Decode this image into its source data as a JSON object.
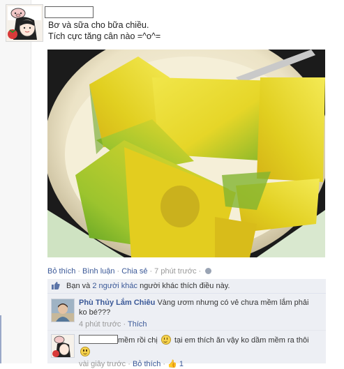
{
  "post": {
    "status_line_1": "Bơ và sữa cho bữa chiều.",
    "status_line_2": "Tích cực tăng cân nào =^o^=",
    "photo_icon": "photo"
  },
  "actions": {
    "like": "Bỏ thích",
    "comment": "Bình luận",
    "share": "Chia sẻ",
    "time": "7 phút trước",
    "separator": "·",
    "privacy_icon": "globe-icon"
  },
  "likes": {
    "prefix": "Bạn và ",
    "others_link": "2 người khác",
    "suffix": " người khác thích điều này.",
    "icon": "thumbs-up-icon"
  },
  "comments": [
    {
      "author": "Phù Thủy Lắm Chiêu",
      "text": "Vàng ươm nhưng có vẻ chưa mềm lắm phải ko bé???",
      "time": "4 phút trước",
      "action": "Thích"
    },
    {
      "text_a": "mềm rồi chị ",
      "text_b": " tại em thích ăn vậy ko dầm mềm ra thôi",
      "time": "vài giây trước",
      "action": "Bỏ thích",
      "likes": "1"
    }
  ],
  "colors": {
    "link": "#3b5998",
    "ufi_background": "#edeff4",
    "muted": "#999999"
  }
}
